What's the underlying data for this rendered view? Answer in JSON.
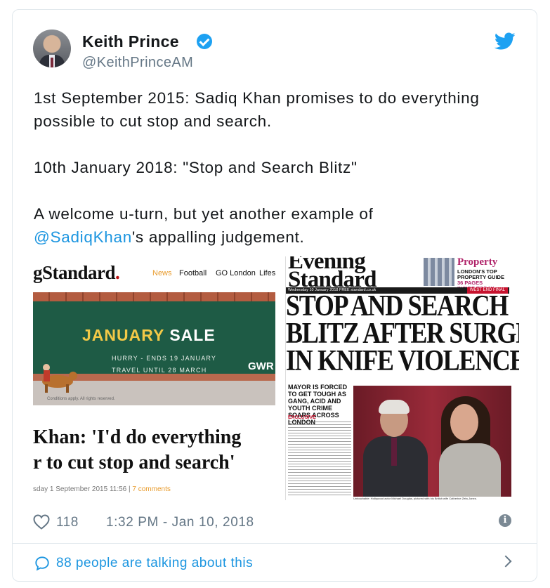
{
  "tweet": {
    "author_name": "Keith Prince",
    "author_handle": "@KeithPrinceAM",
    "lines": [
      "1st September 2015: Sadiq Khan promises to do everything possible to cut stop and search.",
      "10th January 2018: \"Stop and Search Blitz\"",
      "A welcome u-turn, but yet another example of"
    ],
    "mention": "@SadiqKhan",
    "mention_suffix": "'s appalling judgement.",
    "likes": "118",
    "timestamp": "1:32 PM - Jan 10, 2018",
    "talking": "88 people are talking about this",
    "icons": [
      "verified-badge-icon",
      "twitter-bird-icon",
      "heart-icon",
      "info-icon",
      "speech-bubble-icon",
      "chevron-right-icon"
    ]
  },
  "left_image": {
    "logo": "gStandard",
    "nav": [
      "News",
      "Football",
      "GO London",
      "Lifes"
    ],
    "ad_title_a": "JANUARY ",
    "ad_title_b": "SALE",
    "ad_line1": "HURRY - ENDS 19 JANUARY",
    "ad_line2": "TRAVEL UNTIL 28 MARCH",
    "ad_brand": "GWR",
    "ad_credit": "Conditions apply. All rights reserved.",
    "headline_1": "Khan: 'I'd do everything",
    "headline_2": "r to cut stop and search'",
    "date": "sday 1 September 2015 11:56 | ",
    "comments": "7 comments"
  },
  "right_image": {
    "masthead_1": "Evening",
    "masthead_2": "Standard",
    "property_title": "Property",
    "property_s1": "LONDON'S TOP",
    "property_s2": "PROPERTY GUIDE",
    "property_s3": "36 PAGES",
    "property_s4": "INSIDE TODAY",
    "bar_text": "Wednesday 10 January 2018  FREE  standard.co.uk",
    "bar_edition": "WEST END FINAL",
    "headline_1": "STOP AND SEARCH",
    "headline_2": "BLITZ AFTER SURGE",
    "headline_3": "IN KNIFE VIOLENCE",
    "subhead": "MAYOR IS FORCED TO GET TOUGH AS GANG, ACID AND YOUTH CRIME SOARS ACROSS LONDON",
    "exclusive": "EXCLUSIVE",
    "caption": "Untouchable: Hollywood actor Michael Douglas, pictured with his British wife Catherine Zeta-Jones."
  },
  "colors": {
    "link": "#1b95e0",
    "muted": "#657786",
    "verified": "#1da1f2",
    "border": "#e1e8ed",
    "ad_green": "#1e5b45",
    "ad_yellow": "#f3c947",
    "paper_red": "#c7122e"
  }
}
